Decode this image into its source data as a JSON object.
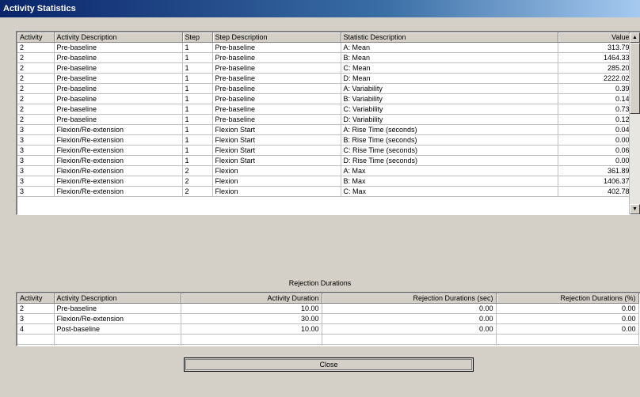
{
  "window": {
    "title": "Activity Statistics"
  },
  "statistics": {
    "columns": [
      "Activity",
      "Activity Description",
      "Step",
      "Step Description",
      "Statistic Description",
      "Value"
    ],
    "rows": [
      [
        "2",
        "Pre-baseline",
        "1",
        "Pre-baseline",
        "A: Mean",
        "313.79"
      ],
      [
        "2",
        "Pre-baseline",
        "1",
        "Pre-baseline",
        "B: Mean",
        "1464.33"
      ],
      [
        "2",
        "Pre-baseline",
        "1",
        "Pre-baseline",
        "C: Mean",
        "285.20"
      ],
      [
        "2",
        "Pre-baseline",
        "1",
        "Pre-baseline",
        "D: Mean",
        "2222.02"
      ],
      [
        "2",
        "Pre-baseline",
        "1",
        "Pre-baseline",
        "A: Variability",
        "0.39"
      ],
      [
        "2",
        "Pre-baseline",
        "1",
        "Pre-baseline",
        "B: Variability",
        "0.14"
      ],
      [
        "2",
        "Pre-baseline",
        "1",
        "Pre-baseline",
        "C: Variability",
        "0.73"
      ],
      [
        "2",
        "Pre-baseline",
        "1",
        "Pre-baseline",
        "D: Variability",
        "0.12"
      ],
      [
        "3",
        "Flexion/Re-extension",
        "1",
        "Flexion Start",
        "A: Rise Time (seconds)",
        "0.04"
      ],
      [
        "3",
        "Flexion/Re-extension",
        "1",
        "Flexion Start",
        "B: Rise Time (seconds)",
        "0.00"
      ],
      [
        "3",
        "Flexion/Re-extension",
        "1",
        "Flexion Start",
        "C: Rise Time (seconds)",
        "0.06"
      ],
      [
        "3",
        "Flexion/Re-extension",
        "1",
        "Flexion Start",
        "D: Rise Time (seconds)",
        "0.00"
      ],
      [
        "3",
        "Flexion/Re-extension",
        "2",
        "Flexion",
        "A: Max",
        "361.89"
      ],
      [
        "3",
        "Flexion/Re-extension",
        "2",
        "Flexion",
        "B: Max",
        "1406.37"
      ],
      [
        "3",
        "Flexion/Re-extension",
        "2",
        "Flexion",
        "C: Max",
        "402.78"
      ]
    ],
    "scroll_up_icon": "triangle-up",
    "scroll_down_icon": "triangle-down"
  },
  "rejection": {
    "label": "Rejection Durations",
    "columns": [
      "Activity",
      "Activity Description",
      "Activity Duration",
      "Rejection Durations (sec)",
      "Rejection Durations (%)"
    ],
    "rows": [
      [
        "2",
        "Pre-baseline",
        "10.00",
        "0.00",
        "0.00"
      ],
      [
        "3",
        "Flexion/Re-extension",
        "30.00",
        "0.00",
        "0.00"
      ],
      [
        "4",
        "Post-baseline",
        "10.00",
        "0.00",
        "0.00"
      ]
    ]
  },
  "buttons": {
    "close": "Close"
  }
}
